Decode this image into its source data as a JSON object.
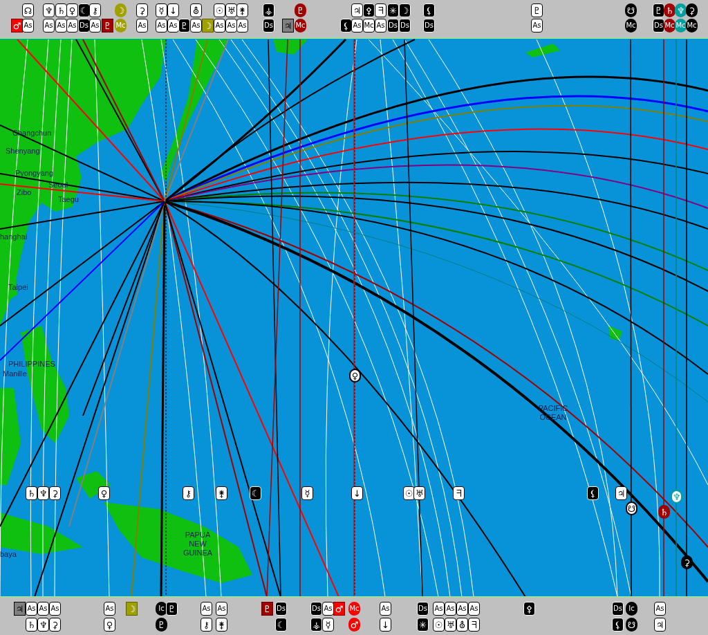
{
  "top_bar": {
    "columns": [
      {
        "lower": {
          "text": "♂",
          "kind": "red"
        }
      },
      {
        "upper": {
          "text": "☊",
          "kind": "plain"
        },
        "lower": {
          "text": "As",
          "kind": "plain"
        }
      },
      {
        "upper": {
          "text": "♆",
          "kind": "plain"
        },
        "lower": {
          "text": "As",
          "kind": "plain"
        }
      },
      {
        "upper": {
          "text": "♄",
          "kind": "plain"
        },
        "lower": {
          "text": "As",
          "kind": "plain"
        }
      },
      {
        "upper": {
          "text": "♀",
          "kind": "plain"
        },
        "lower": {
          "text": "As",
          "kind": "plain"
        }
      },
      {
        "upper": {
          "text": "☾",
          "kind": "black"
        },
        "lower": {
          "text": "Ds",
          "kind": "black"
        }
      },
      {
        "upper": {
          "text": "⚷",
          "kind": "plain"
        },
        "lower": {
          "text": "As",
          "kind": "plain"
        }
      },
      {
        "lower": {
          "text": "♇",
          "kind": "maroon"
        }
      },
      {
        "upper": {
          "text": "☽",
          "kind": "olive-round"
        },
        "lower": {
          "text": "Mc",
          "kind": "olive-round"
        }
      },
      {
        "upper": {
          "text": "⚳",
          "kind": "plain"
        },
        "lower": {
          "text": "As",
          "kind": "plain"
        }
      },
      {
        "upper": {
          "text": "☿",
          "kind": "plain"
        },
        "lower": {
          "text": "As",
          "kind": "plain"
        }
      },
      {
        "upper": {
          "text": "↓",
          "kind": "plain"
        },
        "lower": {
          "text": "As",
          "kind": "plain"
        }
      },
      {
        "lower": {
          "text": "♇",
          "kind": "black"
        }
      },
      {
        "upper": {
          "text": "⛢",
          "kind": "plain"
        },
        "lower": {
          "text": "As",
          "kind": "plain"
        }
      },
      {
        "lower": {
          "text": "☽",
          "kind": "olive"
        }
      },
      {
        "upper": {
          "text": "☉",
          "kind": "plain"
        },
        "lower": {
          "text": "As",
          "kind": "plain"
        }
      },
      {
        "upper": {
          "text": "♅",
          "kind": "plain"
        },
        "lower": {
          "text": "As",
          "kind": "plain"
        }
      },
      {
        "upper": {
          "text": "⚵",
          "kind": "plain"
        },
        "lower": {
          "text": "As",
          "kind": "plain"
        }
      },
      {
        "upper": {
          "text": "⚶",
          "kind": "black"
        },
        "lower": {
          "text": "Ds",
          "kind": "black"
        }
      },
      {
        "lower": {
          "text": "♃",
          "kind": "gray"
        }
      },
      {
        "upper": {
          "text": "♇",
          "kind": "maroon-round"
        },
        "lower": {
          "text": "Mc",
          "kind": "maroon-round"
        }
      },
      {
        "lower": {
          "text": "⚸",
          "kind": "black"
        }
      },
      {
        "upper": {
          "text": "♃",
          "kind": "plain"
        },
        "lower": {
          "text": "As",
          "kind": "plain"
        }
      },
      {
        "upper": {
          "text": "⚴",
          "kind": "black"
        },
        "lower": {
          "text": "Mc",
          "kind": "plain"
        }
      },
      {
        "upper": {
          "text": "ᖷ",
          "kind": "plain"
        },
        "lower": {
          "text": "As",
          "kind": "plain"
        }
      },
      {
        "upper": {
          "text": "✳",
          "kind": "black"
        },
        "lower": {
          "text": "Ds",
          "kind": "black"
        }
      },
      {
        "upper": {
          "text": "☽",
          "kind": "black"
        },
        "lower": {
          "text": "Ds",
          "kind": "black"
        }
      },
      {
        "upper": {
          "text": "⚸",
          "kind": "black"
        },
        "lower": {
          "text": "Ds",
          "kind": "black"
        }
      },
      {
        "upper": {
          "text": "♇",
          "kind": "plain"
        },
        "lower": {
          "text": "As",
          "kind": "plain"
        }
      },
      {
        "upper": {
          "text": "☋",
          "kind": "black-round"
        },
        "lower": {
          "text": "Mc",
          "kind": "black-round"
        }
      },
      {
        "upper": {
          "text": "♇",
          "kind": "black"
        },
        "lower": {
          "text": "Ds",
          "kind": "black"
        }
      },
      {
        "upper": {
          "text": "♄",
          "kind": "maroon-round"
        },
        "lower": {
          "text": "Mc",
          "kind": "maroon-round"
        }
      },
      {
        "upper": {
          "text": "♆",
          "kind": "teal-round"
        },
        "lower": {
          "text": "Mc",
          "kind": "teal-round"
        }
      },
      {
        "upper": {
          "text": "⚳",
          "kind": "black-round"
        },
        "lower": {
          "text": "Mc",
          "kind": "black-round"
        }
      }
    ]
  },
  "map": {
    "labels": [
      "Changchun",
      "Shenyang",
      "Pyongyang",
      "Seoul",
      "Zibo",
      "Taegu",
      "hanghai",
      "Taipei",
      "PHILIPPINES",
      "Manille",
      "PAPUA NEW GUINEA",
      "PACIFIC OCEAN",
      "baya"
    ],
    "markers": [
      {
        "text": "♄",
        "kind": "plain"
      },
      {
        "text": "♆",
        "kind": "plain"
      },
      {
        "text": "⚳",
        "kind": "plain"
      },
      {
        "text": "♀",
        "kind": "plain"
      },
      {
        "text": "⚷",
        "kind": "plain"
      },
      {
        "text": "⚵",
        "kind": "plain"
      },
      {
        "text": "☾",
        "kind": "black"
      },
      {
        "text": "☿",
        "kind": "plain"
      },
      {
        "text": "↓",
        "kind": "plain"
      },
      {
        "text": "☉",
        "kind": "plain"
      },
      {
        "text": "♅",
        "kind": "plain"
      },
      {
        "text": "ᖷ",
        "kind": "plain"
      },
      {
        "text": "⚸",
        "kind": "black"
      },
      {
        "text": "♃",
        "kind": "plain"
      },
      {
        "text": "♆",
        "kind": "teal-ring"
      },
      {
        "text": "♀",
        "kind": "ring"
      },
      {
        "text": "☋",
        "kind": "ring"
      },
      {
        "text": "♄",
        "kind": "maroon-round"
      },
      {
        "text": "⚳",
        "kind": "black-round"
      }
    ]
  },
  "bottom_bar": {
    "columns": [
      {
        "upper": {
          "text": "♃",
          "kind": "gray"
        }
      },
      {
        "upper": {
          "text": "As",
          "kind": "plain"
        },
        "lower": {
          "text": "♄",
          "kind": "plain"
        }
      },
      {
        "upper": {
          "text": "As",
          "kind": "plain"
        },
        "lower": {
          "text": "♆",
          "kind": "plain"
        }
      },
      {
        "upper": {
          "text": "As",
          "kind": "plain"
        },
        "lower": {
          "text": "⚳",
          "kind": "plain"
        }
      },
      {
        "upper": {
          "text": "As",
          "kind": "plain"
        },
        "lower": {
          "text": "♀",
          "kind": "plain"
        }
      },
      {
        "upper": {
          "text": "☽",
          "kind": "olive"
        }
      },
      {
        "upper": {
          "text": "Ic",
          "kind": "black-round"
        },
        "lower": {
          "text": "♇",
          "kind": "black-round"
        }
      },
      {
        "upper": {
          "text": "♇",
          "kind": "black"
        }
      },
      {
        "upper": {
          "text": "As",
          "kind": "plain"
        },
        "lower": {
          "text": "⚷",
          "kind": "plain"
        }
      },
      {
        "upper": {
          "text": "As",
          "kind": "plain"
        },
        "lower": {
          "text": "⚵",
          "kind": "plain"
        }
      },
      {
        "upper": {
          "text": "♇",
          "kind": "maroon"
        }
      },
      {
        "upper": {
          "text": "Ds",
          "kind": "black"
        },
        "lower": {
          "text": "☾",
          "kind": "black"
        }
      },
      {
        "upper": {
          "text": "Ds",
          "kind": "black"
        },
        "lower": {
          "text": "⚶",
          "kind": "black"
        }
      },
      {
        "upper": {
          "text": "As",
          "kind": "plain"
        },
        "lower": {
          "text": "☿",
          "kind": "plain"
        }
      },
      {
        "upper": {
          "text": "♂",
          "kind": "red"
        }
      },
      {
        "upper": {
          "text": "Mc",
          "kind": "red-round"
        },
        "lower": {
          "text": "♂",
          "kind": "red-round"
        }
      },
      {
        "upper": {
          "text": "As",
          "kind": "plain"
        },
        "lower": {
          "text": "↓",
          "kind": "plain"
        }
      },
      {
        "upper": {
          "text": "Ds",
          "kind": "black"
        },
        "lower": {
          "text": "✳",
          "kind": "black"
        }
      },
      {
        "upper": {
          "text": "As",
          "kind": "plain"
        },
        "lower": {
          "text": "☉",
          "kind": "plain"
        }
      },
      {
        "upper": {
          "text": "As",
          "kind": "plain"
        },
        "lower": {
          "text": "♅",
          "kind": "plain"
        }
      },
      {
        "upper": {
          "text": "As",
          "kind": "plain"
        },
        "lower": {
          "text": "⛢",
          "kind": "plain"
        }
      },
      {
        "upper": {
          "text": "As",
          "kind": "plain"
        },
        "lower": {
          "text": "ᖷ",
          "kind": "plain"
        }
      },
      {
        "upper": {
          "text": "⚴",
          "kind": "black"
        }
      },
      {
        "upper": {
          "text": "Ds",
          "kind": "black"
        },
        "lower": {
          "text": "⚸",
          "kind": "black"
        }
      },
      {
        "upper": {
          "text": "Ic",
          "kind": "black-round"
        },
        "lower": {
          "text": "☋",
          "kind": "black-round"
        }
      },
      {
        "upper": {
          "text": "As",
          "kind": "plain"
        },
        "lower": {
          "text": "♃",
          "kind": "plain"
        }
      }
    ]
  }
}
